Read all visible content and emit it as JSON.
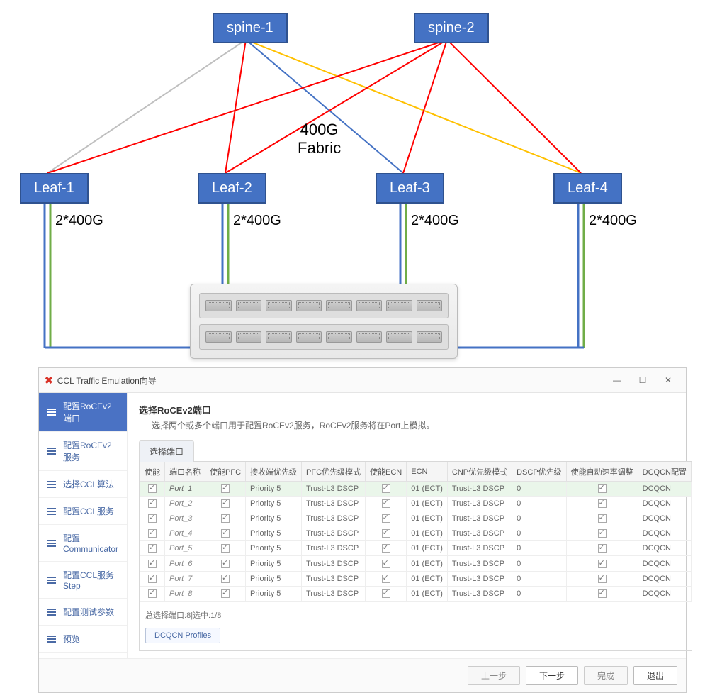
{
  "diagram": {
    "spine1": "spine-1",
    "spine2": "spine-2",
    "leaf1": "Leaf-1",
    "leaf2": "Leaf-2",
    "leaf3": "Leaf-3",
    "leaf4": "Leaf-4",
    "fabric_line1": "400G",
    "fabric_line2": "Fabric",
    "port_label": "2*400G"
  },
  "window": {
    "title": "CCL Traffic Emulation向导",
    "minimize": "—",
    "maximize": "☐",
    "close": "✕"
  },
  "sidebar": {
    "items": [
      "配置RoCEv2端口",
      "配置RoCEv2服务",
      "选择CCL算法",
      "配置CCL服务",
      "配置Communicator",
      "配置CCL服务Step",
      "配置测试参数",
      "预览"
    ]
  },
  "main": {
    "title": "选择RoCEv2端口",
    "desc": "选择两个或多个端口用于配置RoCEv2服务，RoCEv2服务将在Port上模拟。",
    "tab": "选择端口"
  },
  "table": {
    "headers": [
      "使能",
      "端口名称",
      "使能PFC",
      "接收端优先级",
      "PFC优先级模式",
      "使能ECN",
      "ECN",
      "CNP优先级模式",
      "DSCP优先级",
      "使能自动速率调整",
      "DCQCN配置"
    ],
    "rows": [
      {
        "name": "Port_1",
        "prio": "Priority 5",
        "pfc": "Trust-L3 DSCP",
        "ecn": "01 (ECT)",
        "cnp": "Trust-L3 DSCP",
        "dscp": "0",
        "dcqcn": "DCQCN",
        "sel": true
      },
      {
        "name": "Port_2",
        "prio": "Priority 5",
        "pfc": "Trust-L3 DSCP",
        "ecn": "01 (ECT)",
        "cnp": "Trust-L3 DSCP",
        "dscp": "0",
        "dcqcn": "DCQCN",
        "sel": false
      },
      {
        "name": "Port_3",
        "prio": "Priority 5",
        "pfc": "Trust-L3 DSCP",
        "ecn": "01 (ECT)",
        "cnp": "Trust-L3 DSCP",
        "dscp": "0",
        "dcqcn": "DCQCN",
        "sel": false
      },
      {
        "name": "Port_4",
        "prio": "Priority 5",
        "pfc": "Trust-L3 DSCP",
        "ecn": "01 (ECT)",
        "cnp": "Trust-L3 DSCP",
        "dscp": "0",
        "dcqcn": "DCQCN",
        "sel": false
      },
      {
        "name": "Port_5",
        "prio": "Priority 5",
        "pfc": "Trust-L3 DSCP",
        "ecn": "01 (ECT)",
        "cnp": "Trust-L3 DSCP",
        "dscp": "0",
        "dcqcn": "DCQCN",
        "sel": false
      },
      {
        "name": "Port_6",
        "prio": "Priority 5",
        "pfc": "Trust-L3 DSCP",
        "ecn": "01 (ECT)",
        "cnp": "Trust-L3 DSCP",
        "dscp": "0",
        "dcqcn": "DCQCN",
        "sel": false
      },
      {
        "name": "Port_7",
        "prio": "Priority 5",
        "pfc": "Trust-L3 DSCP",
        "ecn": "01 (ECT)",
        "cnp": "Trust-L3 DSCP",
        "dscp": "0",
        "dcqcn": "DCQCN",
        "sel": false
      },
      {
        "name": "Port_8",
        "prio": "Priority 5",
        "pfc": "Trust-L3 DSCP",
        "ecn": "01 (ECT)",
        "cnp": "Trust-L3 DSCP",
        "dscp": "0",
        "dcqcn": "DCQCN",
        "sel": false
      }
    ],
    "summary": "总选择端口:8|选中:1/8",
    "profiles_btn": "DCQCN Profiles"
  },
  "footer": {
    "prev": "上一步",
    "next": "下一步",
    "finish": "完成",
    "exit": "退出"
  }
}
